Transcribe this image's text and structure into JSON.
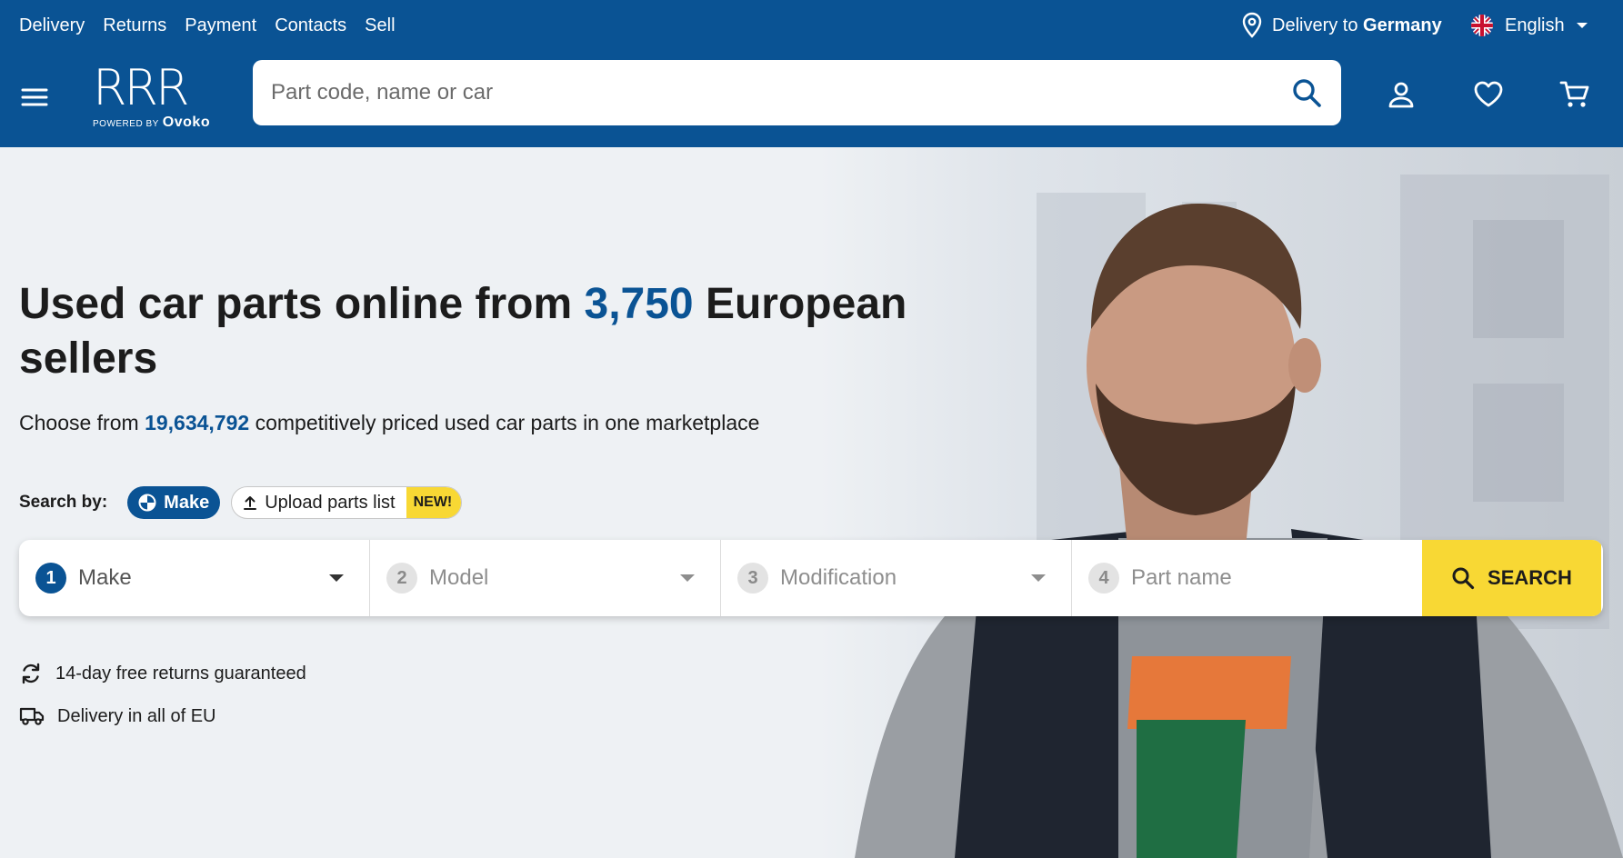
{
  "topbar": {
    "nav": [
      "Delivery",
      "Returns",
      "Payment",
      "Contacts",
      "Sell"
    ],
    "delivery_prefix": "Delivery to",
    "delivery_country": "Germany",
    "language": "English"
  },
  "header": {
    "logo_text": "RRR",
    "logo_powered": "POWERED BY",
    "logo_brand": "Ovoko",
    "search_placeholder": "Part code, name or car",
    "icons": [
      "menu-icon",
      "search-icon",
      "user-icon",
      "heart-icon",
      "cart-icon"
    ]
  },
  "hero": {
    "title_pre": "Used car parts online from ",
    "title_sellers": "3,750",
    "title_post": " European sellers",
    "subtitle_pre": "Choose from ",
    "subtitle_count": "19,634,792",
    "subtitle_post": " competitively priced used car parts in one marketplace"
  },
  "search_by": {
    "label": "Search by:",
    "make": "Make",
    "upload": "Upload parts list",
    "new_badge": "NEW!"
  },
  "selector": {
    "steps": [
      {
        "num": "1",
        "label": "Make"
      },
      {
        "num": "2",
        "label": "Model"
      },
      {
        "num": "3",
        "label": "Modification"
      },
      {
        "num": "4",
        "label": "Part name"
      }
    ],
    "submit": "SEARCH"
  },
  "features": [
    "14-day free returns guaranteed",
    "Delivery in all of EU"
  ],
  "colors": {
    "brand_blue": "#0a5394",
    "accent_yellow": "#f8d834",
    "background": "#eef1f4"
  }
}
